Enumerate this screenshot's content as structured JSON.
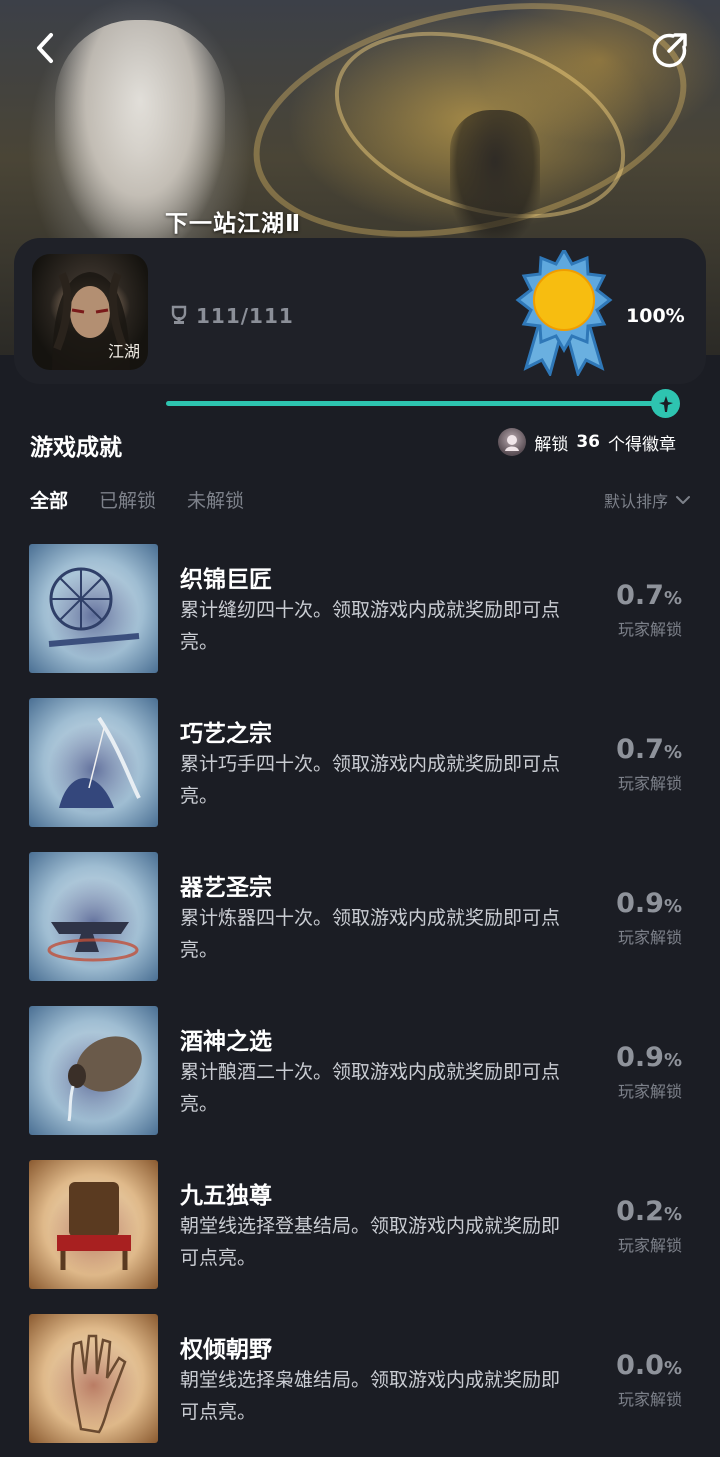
{
  "hero": {
    "caption": "下一站江湖Ⅱ",
    "back_icon": "chevron-left-icon",
    "share_icon": "share-icon"
  },
  "summary": {
    "cover_text": "江湖",
    "trophy_icon": "trophy-icon",
    "trophy_count": "111/111",
    "medal_icon": "sun-medal-icon",
    "percent": "100%",
    "progress": 1.0
  },
  "section": {
    "title": "游戏成就",
    "badge_prefix": "解锁",
    "badge_count": "36",
    "badge_suffix": "个得徽章"
  },
  "tabs": [
    "全部",
    "已解锁",
    "未解锁"
  ],
  "sort_label": "默认排序",
  "unlock_label": "玩家解锁",
  "colors": {
    "background": "#1b1d24",
    "card": "#1f2128",
    "accent": "#2ec4b0",
    "muted": "#7d818a"
  },
  "achievements": [
    {
      "title": "织锦巨匠",
      "desc": "累计缝纫四十次。领取游戏内成就奖励即可点亮。",
      "pct": "0.7",
      "unit": "%",
      "theme": "blue"
    },
    {
      "title": "巧艺之宗",
      "desc": "累计巧手四十次。领取游戏内成就奖励即可点亮。",
      "pct": "0.7",
      "unit": "%",
      "theme": "blue"
    },
    {
      "title": "器艺圣宗",
      "desc": "累计炼器四十次。领取游戏内成就奖励即可点亮。",
      "pct": "0.9",
      "unit": "%",
      "theme": "blue"
    },
    {
      "title": "酒神之选",
      "desc": "累计酿酒二十次。领取游戏内成就奖励即可点亮。",
      "pct": "0.9",
      "unit": "%",
      "theme": "blue"
    },
    {
      "title": "九五独尊",
      "desc": "朝堂线选择登基结局。领取游戏内成就奖励即可点亮。",
      "pct": "0.2",
      "unit": "%",
      "theme": "warm"
    },
    {
      "title": "权倾朝野",
      "desc": "朝堂线选择枭雄结局。领取游戏内成就奖励即可点亮。",
      "pct": "0.0",
      "unit": "%",
      "theme": "warm"
    }
  ]
}
